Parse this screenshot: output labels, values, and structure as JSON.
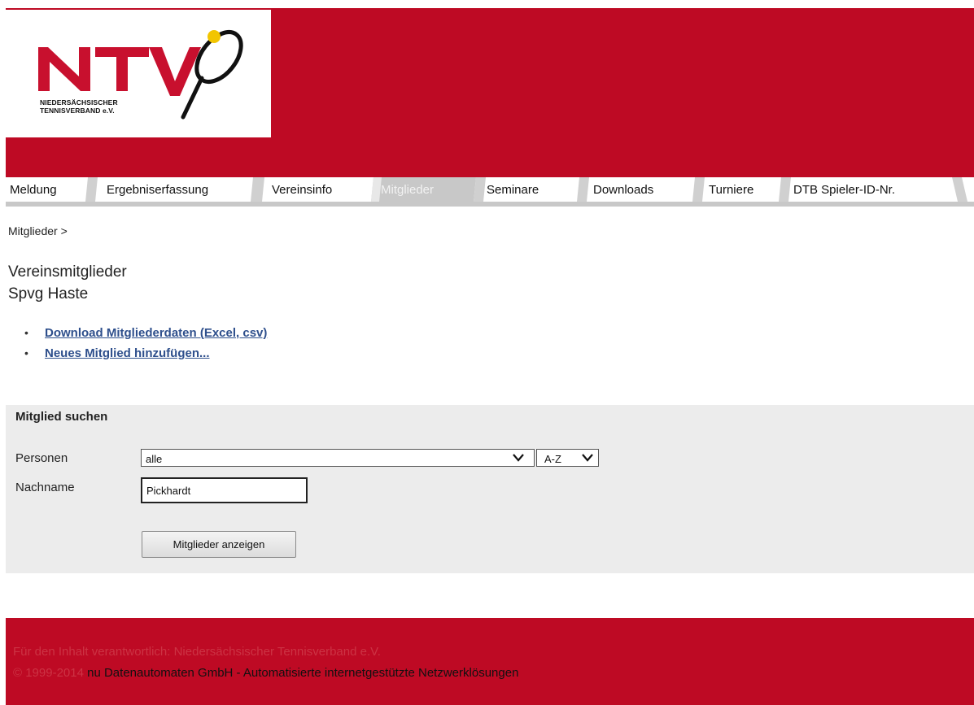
{
  "brand": {
    "logo_letters": "NTV",
    "logo_line1": "NIEDERSÄCHSISCHER",
    "logo_line2": "TENNISVERBAND e.V.",
    "primary_color": "#be0a24"
  },
  "nav": {
    "tabs": [
      {
        "label": "Meldung",
        "active": false
      },
      {
        "label": "Ergebniserfassung",
        "active": false
      },
      {
        "label": "Vereinsinfo",
        "active": false
      },
      {
        "label": "Mitglieder",
        "active": true
      },
      {
        "label": "Seminare",
        "active": false
      },
      {
        "label": "Downloads",
        "active": false
      },
      {
        "label": "Turniere",
        "active": false
      },
      {
        "label": "DTB Spieler-ID-Nr.",
        "active": false
      }
    ]
  },
  "breadcrumb": "Mitglieder >",
  "page": {
    "title": "Vereinsmitglieder",
    "subtitle": "Spvg Haste",
    "links": [
      {
        "bullet": "•",
        "label": "Download Mitgliederdaten (Excel, csv)"
      },
      {
        "bullet": "•",
        "label": "Neues Mitglied hinzufügen..."
      }
    ]
  },
  "search": {
    "title": "Mitglied suchen",
    "personen_label": "Personen",
    "personen_value": "alle",
    "sort_value": "A-Z",
    "nachname_label": "Nachname",
    "nachname_value": "Pickhardt",
    "submit_label": "Mitglieder anzeigen"
  },
  "footer": {
    "line1": "Für den Inhalt verantwortlich: Niedersächsischer Tennisverband e.V.",
    "line2_prefix": "© 1999-2014 ",
    "line2_company": "nu Datenautomaten GmbH - Automatisierte internetgestützte Netzwerklösungen"
  }
}
